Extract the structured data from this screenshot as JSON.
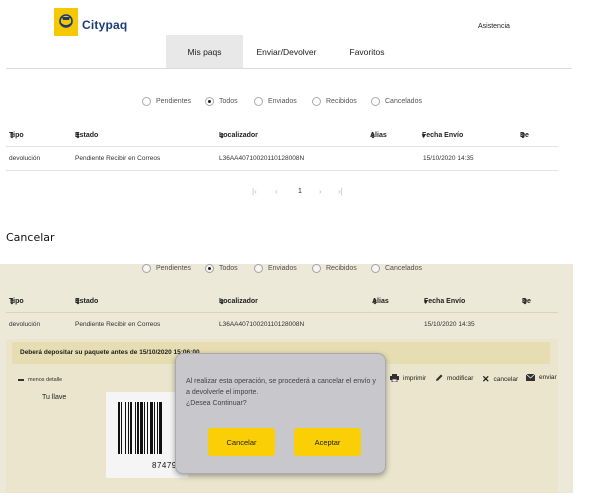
{
  "brand": {
    "name": "Citypaq",
    "accent": "#f5c800",
    "text_color": "#1b3a78"
  },
  "header": {
    "assist": "Asistencia"
  },
  "tabs": [
    {
      "label": "Mis paqs"
    },
    {
      "label": "Enviar/Devolver"
    },
    {
      "label": "Favoritos"
    }
  ],
  "filters": {
    "selected": "Todos",
    "options": [
      {
        "label": "Pendientes"
      },
      {
        "label": "Todos"
      },
      {
        "label": "Enviados"
      },
      {
        "label": "Recibidos"
      },
      {
        "label": "Cancelados"
      }
    ]
  },
  "table": {
    "columns": [
      {
        "label": "Tipo"
      },
      {
        "label": "Estado"
      },
      {
        "label": "Localizador"
      },
      {
        "label": "Alias"
      },
      {
        "label": "Fecha Envío"
      },
      {
        "label": "De"
      }
    ],
    "rows": [
      {
        "tipo": "devolución",
        "estado": "Pendiente Recibir en Correos",
        "localizador": "L36AA40710020110128008N",
        "alias": "",
        "fecha": "15/10/2020 14:35",
        "de": ""
      }
    ]
  },
  "pagination": {
    "current_page": "1"
  },
  "section_title": "Cancelar",
  "detail": {
    "deposit_notice": "Deberá depositar su paquete antes de 15/10/2020 15:06:00",
    "less_detail": "menos detalle",
    "key_label": "Tu llave",
    "barcode_number": "87479",
    "actions": [
      {
        "label": "imprimir"
      },
      {
        "label": "modificar"
      },
      {
        "label": "cancelar"
      },
      {
        "label": "enviar"
      }
    ]
  },
  "modal": {
    "line1": "Al realizar esta operación, se procederá a cancelar el envío y",
    "line2": "a devolverle el importe.",
    "line3": "¿Desea Continuar?",
    "cancel_label": "Cancelar",
    "accept_label": "Aceptar",
    "button_color": "#fbcf06"
  }
}
